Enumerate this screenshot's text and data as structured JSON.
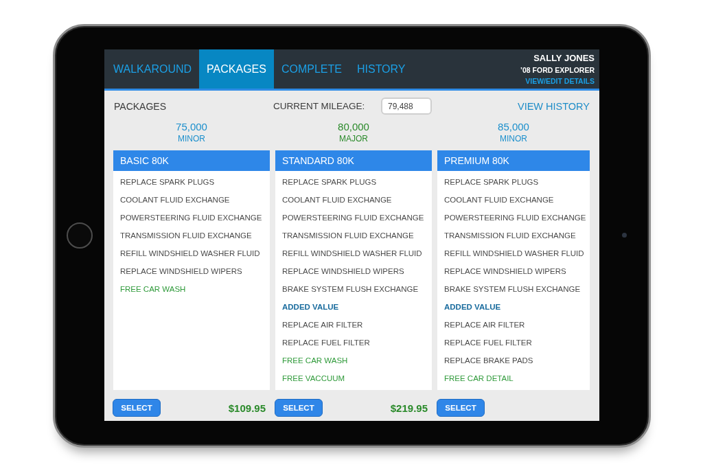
{
  "tabs": [
    {
      "label": "WALKAROUND",
      "selected": false
    },
    {
      "label": "PACKAGES",
      "selected": true
    },
    {
      "label": "COMPLETE",
      "selected": false
    },
    {
      "label": "HISTORY",
      "selected": false
    }
  ],
  "customer": {
    "name": "SALLY JONES",
    "vehicle": "’08 FORD EXPLORER",
    "link": "VIEW/EDIT DETAILS"
  },
  "toolbar": {
    "title": "PACKAGES",
    "mileage_label": "CURRENT MILEAGE:",
    "mileage_value": "79,488",
    "history_link": "VIEW HISTORY"
  },
  "milestones": [
    {
      "mileage": "75,000",
      "service": "MINOR",
      "current": false
    },
    {
      "mileage": "80,000",
      "service": "MAJOR",
      "current": true
    },
    {
      "mileage": "85,000",
      "service": "MINOR",
      "current": false
    }
  ],
  "packages": [
    {
      "name": "BASIC 80K",
      "items": [
        {
          "kind": "service",
          "text": "REPLACE SPARK PLUGS"
        },
        {
          "kind": "service",
          "text": "COOLANT FLUID EXCHANGE"
        },
        {
          "kind": "service",
          "text": "POWERSTEERING FLUID EXCHANGE"
        },
        {
          "kind": "service",
          "text": "TRANSMISSION FLUID EXCHANGE"
        },
        {
          "kind": "service",
          "text": "REFILL WINDSHIELD WASHER FLUID"
        },
        {
          "kind": "service",
          "text": "REPLACE WINDSHIELD WIPERS"
        },
        {
          "kind": "bonus",
          "text": "FREE CAR WASH"
        }
      ],
      "button": "SELECT",
      "price": "$109.95"
    },
    {
      "name": "STANDARD 80K",
      "items": [
        {
          "kind": "service",
          "text": "REPLACE SPARK PLUGS"
        },
        {
          "kind": "service",
          "text": "COOLANT FLUID EXCHANGE"
        },
        {
          "kind": "service",
          "text": "POWERSTEERING FLUID EXCHANGE"
        },
        {
          "kind": "service",
          "text": "TRANSMISSION FLUID EXCHANGE"
        },
        {
          "kind": "service",
          "text": "REFILL WINDSHIELD WASHER FLUID"
        },
        {
          "kind": "service",
          "text": "REPLACE WINDSHIELD WIPERS"
        },
        {
          "kind": "service",
          "text": "BRAKE SYSTEM FLUSH EXCHANGE"
        },
        {
          "kind": "section",
          "text": "ADDED VALUE"
        },
        {
          "kind": "service",
          "text": "REPLACE AIR FILTER"
        },
        {
          "kind": "service",
          "text": "REPLACE FUEL FILTER"
        },
        {
          "kind": "bonus",
          "text": "FREE CAR WASH"
        },
        {
          "kind": "bonus",
          "text": "FREE VACCUUM"
        }
      ],
      "button": "SELECT",
      "price": "$219.95"
    },
    {
      "name": "PREMIUM 80K",
      "items": [
        {
          "kind": "service",
          "text": "REPLACE SPARK PLUGS"
        },
        {
          "kind": "service",
          "text": "COOLANT FLUID EXCHANGE"
        },
        {
          "kind": "service",
          "text": "POWERSTEERING FLUID EXCHANGE"
        },
        {
          "kind": "service",
          "text": "TRANSMISSION FLUID EXCHANGE"
        },
        {
          "kind": "service",
          "text": "REFILL WINDSHIELD WASHER FLUID"
        },
        {
          "kind": "service",
          "text": "REPLACE WINDSHIELD WIPERS"
        },
        {
          "kind": "service",
          "text": "BRAKE SYSTEM FLUSH EXCHANGE"
        },
        {
          "kind": "section",
          "text": "ADDED VALUE"
        },
        {
          "kind": "service",
          "text": "REPLACE AIR FILTER"
        },
        {
          "kind": "service",
          "text": "REPLACE FUEL FILTER"
        },
        {
          "kind": "service",
          "text": "REPLACE BRAKE PADS"
        },
        {
          "kind": "bonus",
          "text": "FREE CAR DETAIL"
        }
      ],
      "button": "SELECT"
    }
  ]
}
